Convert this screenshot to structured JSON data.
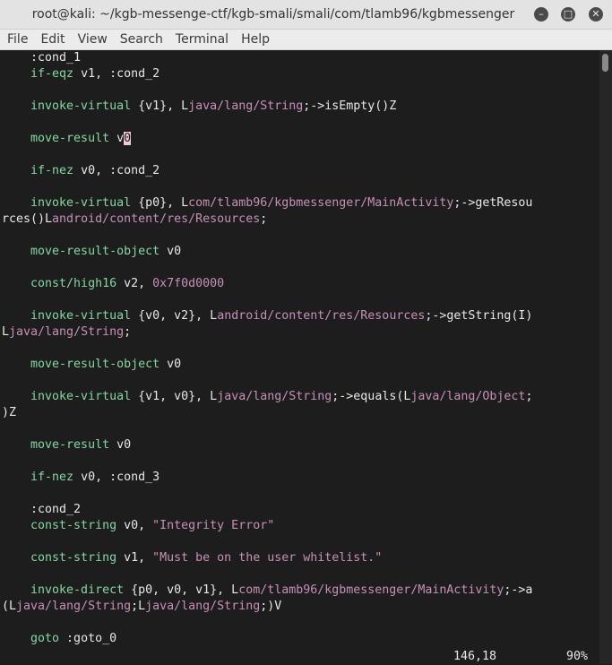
{
  "window": {
    "title": "root@kali: ~/kgb-messenge-ctf/kgb-smali/smali/com/tlamb96/kgbmessenger",
    "buttons": {
      "minimize_icon": "minimize-icon",
      "maximize_icon": "maximize-icon",
      "close_icon": "close-icon"
    }
  },
  "menubar": {
    "items": [
      "File",
      "Edit",
      "View",
      "Search",
      "Terminal",
      "Help"
    ]
  },
  "colors": {
    "keyword": "#86d6a2",
    "literal": "#c88fb8",
    "text": "#e8e8e8",
    "background": "#1d1d1d"
  },
  "terminal": {
    "lines": [
      [
        [
          "t",
          "    :cond_1"
        ]
      ],
      [
        [
          "k",
          "    if-eqz"
        ],
        [
          "t",
          " v1, :cond_2"
        ]
      ],
      [],
      [
        [
          "k",
          "    invoke-virtual"
        ],
        [
          "t",
          " {v1}, L"
        ],
        [
          "l",
          "java/lang/String"
        ],
        [
          "t",
          ";->isEmpty()Z"
        ]
      ],
      [],
      [
        [
          "k",
          "    move-result"
        ],
        [
          "t",
          " v"
        ],
        [
          "c",
          "0"
        ]
      ],
      [],
      [
        [
          "k",
          "    if-nez"
        ],
        [
          "t",
          " v0, :cond_2"
        ]
      ],
      [],
      [
        [
          "k",
          "    invoke-virtual"
        ],
        [
          "t",
          " {p0}, L"
        ],
        [
          "l",
          "com/tlamb96/kgbmessenger/MainActivity"
        ],
        [
          "t",
          ";->getResou"
        ]
      ],
      [
        [
          "t",
          "rces()L"
        ],
        [
          "l",
          "android/content/res/Resources"
        ],
        [
          "t",
          ";"
        ]
      ],
      [],
      [
        [
          "k",
          "    move-result-object"
        ],
        [
          "t",
          " v0"
        ]
      ],
      [],
      [
        [
          "k",
          "    const/high16"
        ],
        [
          "t",
          " v2, "
        ],
        [
          "l",
          "0x7f0d0000"
        ]
      ],
      [],
      [
        [
          "k",
          "    invoke-virtual"
        ],
        [
          "t",
          " {v0, v2}, L"
        ],
        [
          "l",
          "android/content/res/Resources"
        ],
        [
          "t",
          ";->getString(I)"
        ]
      ],
      [
        [
          "t",
          "L"
        ],
        [
          "l",
          "java/lang/String"
        ],
        [
          "t",
          ";"
        ]
      ],
      [],
      [
        [
          "k",
          "    move-result-object"
        ],
        [
          "t",
          " v0"
        ]
      ],
      [],
      [
        [
          "k",
          "    invoke-virtual"
        ],
        [
          "t",
          " {v1, v0}, L"
        ],
        [
          "l",
          "java/lang/String"
        ],
        [
          "t",
          ";->equals(L"
        ],
        [
          "l",
          "java/lang/Object"
        ],
        [
          "t",
          ";"
        ]
      ],
      [
        [
          "t",
          ")Z"
        ]
      ],
      [],
      [
        [
          "k",
          "    move-result"
        ],
        [
          "t",
          " v0"
        ]
      ],
      [],
      [
        [
          "k",
          "    if-nez"
        ],
        [
          "t",
          " v0, :cond_3"
        ]
      ],
      [],
      [
        [
          "t",
          "    :cond_2"
        ]
      ],
      [
        [
          "k",
          "    const-string"
        ],
        [
          "t",
          " v0, "
        ],
        [
          "l",
          "\"Integrity Error\""
        ]
      ],
      [],
      [
        [
          "k",
          "    const-string"
        ],
        [
          "t",
          " v1, "
        ],
        [
          "l",
          "\"Must be on the user whitelist.\""
        ]
      ],
      [],
      [
        [
          "k",
          "    invoke-direct"
        ],
        [
          "t",
          " {p0, v0, v1}, L"
        ],
        [
          "l",
          "com/tlamb96/kgbmessenger/MainActivity"
        ],
        [
          "t",
          ";->a"
        ]
      ],
      [
        [
          "t",
          "(L"
        ],
        [
          "l",
          "java/lang/String"
        ],
        [
          "t",
          ";L"
        ],
        [
          "l",
          "java/lang/String"
        ],
        [
          "t",
          ";)V"
        ]
      ],
      [],
      [
        [
          "k",
          "    goto"
        ],
        [
          "t",
          " :goto_0"
        ]
      ]
    ],
    "status_position": "146,18",
    "status_percent": "90%",
    "scroll_fraction": 0.9
  }
}
